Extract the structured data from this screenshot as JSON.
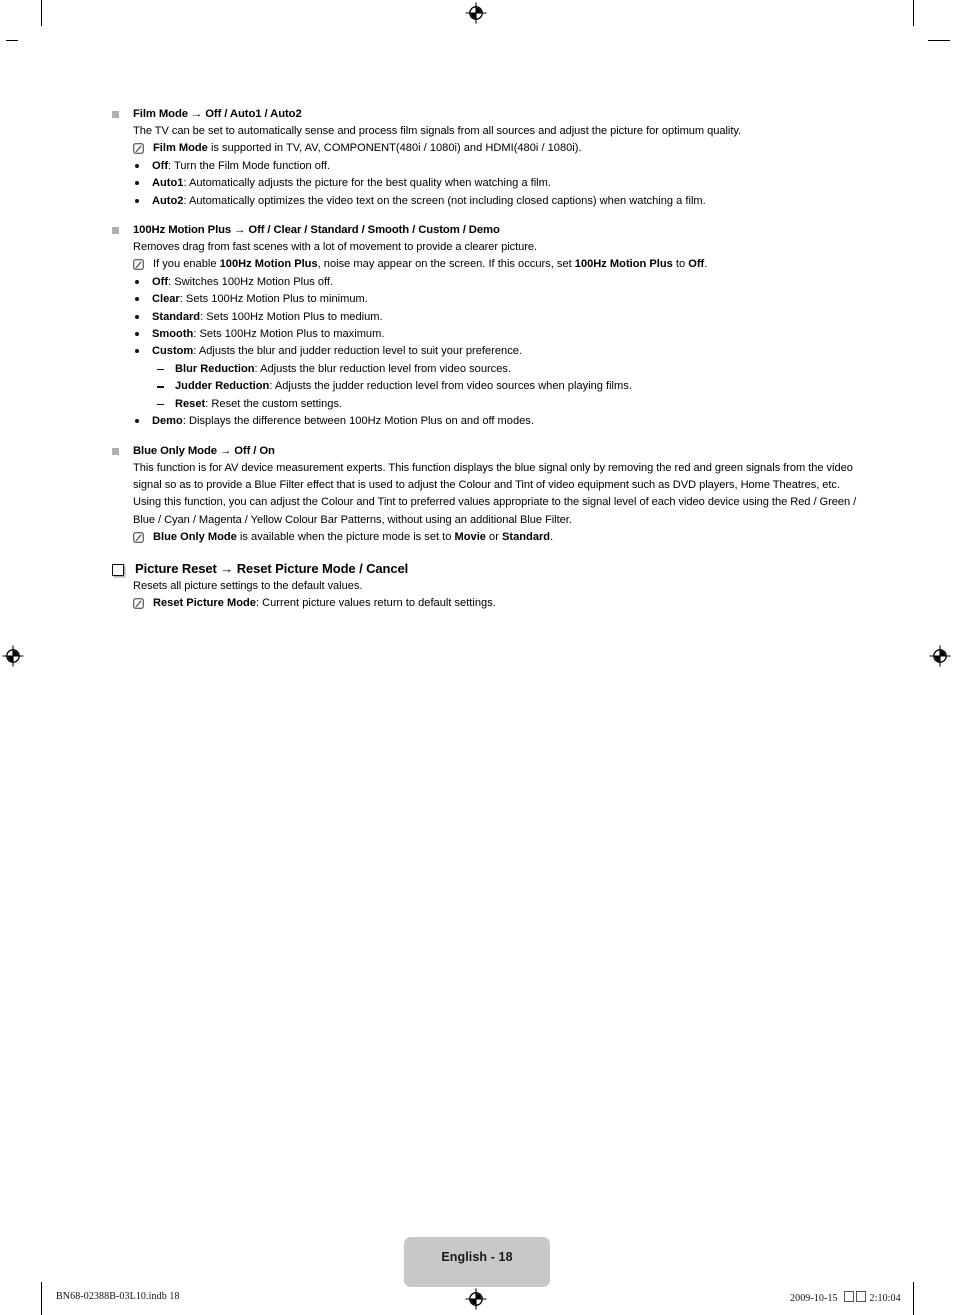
{
  "document": {
    "page_label": "English - 18",
    "imprint_left": "BN68-02388B-03L10.indb   18",
    "imprint_date": "2009-10-15",
    "imprint_time": "2:10:04",
    "colors": {
      "marker_square": "#b0b0b0",
      "footer_badge": "#c8c8c8",
      "text": "#000000"
    }
  },
  "sections": [
    {
      "marker": "gray-square",
      "heading": "Film Mode → Off / Auto1 / Auto2",
      "paragraph": "The TV can be set to automatically sense and process film signals from all sources and adjust the picture for optimum quality.",
      "note": {
        "bold_lead": "Film Mode",
        "rest": " is supported in TV, AV, COMPONENT(480i / 1080i) and HDMI(480i / 1080i)."
      },
      "items": [
        {
          "term": "Off",
          "desc": ": Turn the Film Mode function off."
        },
        {
          "term": "Auto1",
          "desc": ": Automatically adjusts the picture for the best quality when watching a film."
        },
        {
          "term": "Auto2",
          "desc": ": Automatically optimizes the video text on the screen (not including closed captions) when watching a film."
        }
      ]
    },
    {
      "marker": "gray-square",
      "heading": "100Hz Motion Plus → Off / Clear / Standard / Smooth / Custom / Demo",
      "paragraph": "Removes drag from fast scenes with a lot of movement to provide a clearer picture.",
      "note_parts": [
        {
          "text": "If you enable ",
          "bold": false
        },
        {
          "text": "100Hz Motion Plus",
          "bold": true
        },
        {
          "text": ", noise may appear on the screen. If this occurs, set ",
          "bold": false
        },
        {
          "text": "100Hz Motion Plus",
          "bold": true
        },
        {
          "text": " to ",
          "bold": false
        },
        {
          "text": "Off",
          "bold": true
        },
        {
          "text": ".",
          "bold": false
        }
      ],
      "items": [
        {
          "term": "Off",
          "desc": ": Switches 100Hz Motion Plus off."
        },
        {
          "term": "Clear",
          "desc": ": Sets 100Hz Motion Plus to minimum."
        },
        {
          "term": "Standard",
          "desc": ": Sets 100Hz Motion Plus to medium."
        },
        {
          "term": "Smooth",
          "desc": ": Sets 100Hz Motion Plus to maximum."
        },
        {
          "term": "Custom",
          "desc": ": Adjusts the blur and judder reduction level to suit your preference.",
          "subitems": [
            {
              "term": "Blur Reduction",
              "desc": ": Adjusts the blur reduction level from video sources."
            },
            {
              "term": "Judder Reduction",
              "desc": ": Adjusts the judder reduction level from video sources when playing films."
            },
            {
              "term": "Reset",
              "desc": ": Reset the custom settings."
            }
          ]
        },
        {
          "term": "Demo",
          "desc": ": Displays the difference between 100Hz Motion Plus on and off modes."
        }
      ]
    },
    {
      "marker": "gray-square",
      "heading": "Blue Only Mode → Off / On",
      "paragraph": "This function is for AV device measurement experts. This function displays the blue signal only by removing the red and green signals from the video signal so as to provide a Blue Filter effect that is used to adjust the Colour and Tint of video equipment such as DVD players, Home Theatres, etc. Using this function, you can adjust the Colour and Tint to preferred values appropriate to the signal level of each video device using the Red / Green / Blue / Cyan / Magenta / Yellow Colour Bar Patterns, without using an additional Blue Filter.",
      "note_parts": [
        {
          "text": "Blue Only Mode",
          "bold": true
        },
        {
          "text": " is available when the picture mode is set to ",
          "bold": false
        },
        {
          "text": "Movie",
          "bold": true
        },
        {
          "text": " or ",
          "bold": false
        },
        {
          "text": "Standard",
          "bold": true
        },
        {
          "text": ".",
          "bold": false
        }
      ]
    },
    {
      "marker": "hollow-square",
      "big": true,
      "heading": "Picture Reset → Reset Picture Mode / Cancel",
      "paragraph": "Resets all picture settings to the default values.",
      "note": {
        "bold_lead": "Reset Picture Mode",
        "rest": ": Current picture values return to default settings."
      }
    }
  ]
}
